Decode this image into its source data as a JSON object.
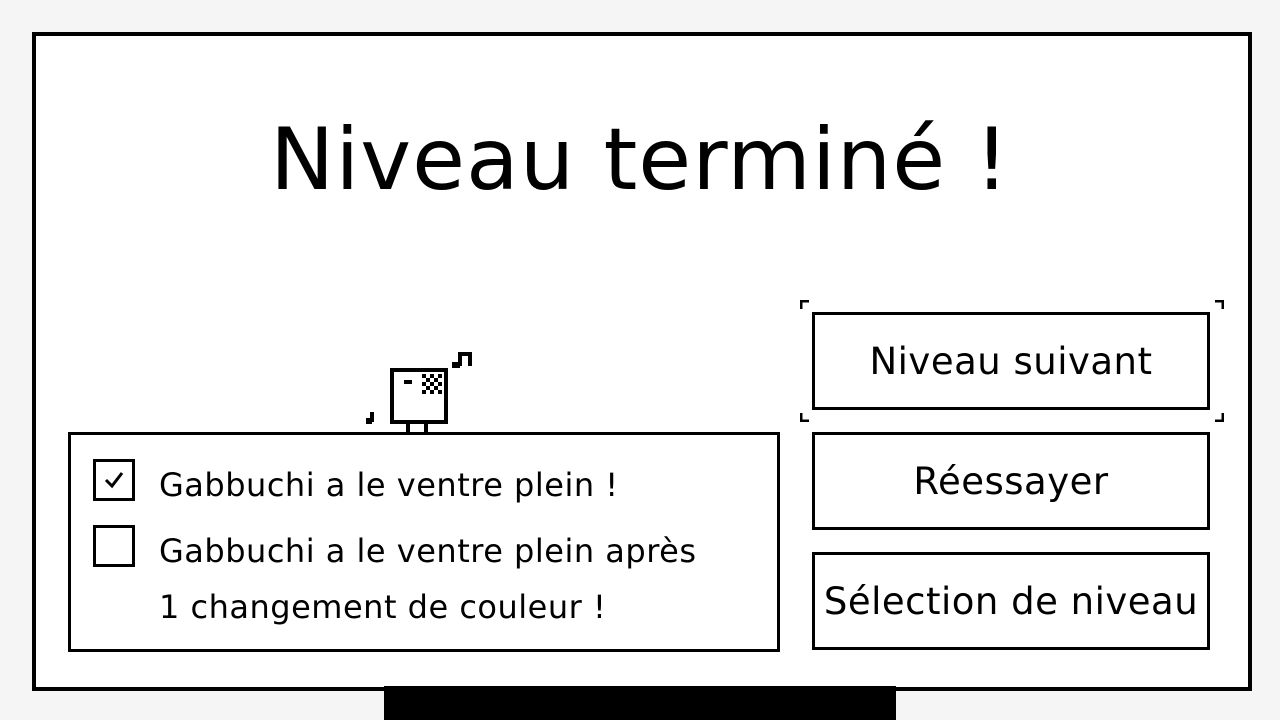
{
  "title": "Niveau terminé !",
  "objectives": [
    {
      "text": "Gabbuchi a le ventre plein !",
      "checked": true
    },
    {
      "text": "Gabbuchi a le ventre plein après 1 changement de couleur !",
      "checked": false
    }
  ],
  "buttons": {
    "next": "Niveau suivant",
    "retry": "Réessayer",
    "level_select": "Sélection de niveau"
  },
  "selected_button": "next",
  "icons": [
    "gabbuchi-character-icon",
    "music-note-icon",
    "checkmark-icon",
    "selection-corner-icon"
  ]
}
